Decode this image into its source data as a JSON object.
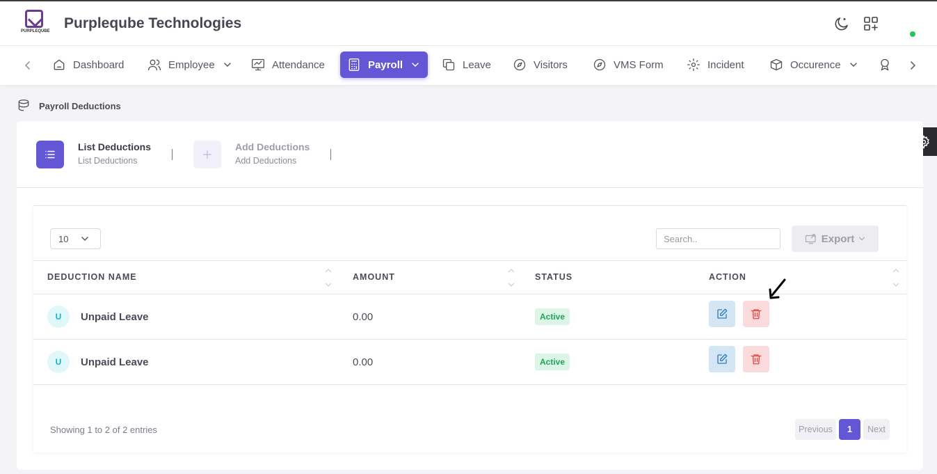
{
  "header": {
    "logo_text": "PURPLEQUBE",
    "company_name": "Purpleqube Technologies",
    "icons": [
      "moon-icon",
      "apps-icon"
    ],
    "status_color": "#22c55e"
  },
  "nav": {
    "items": [
      {
        "label": "Dashboard",
        "icon": "home-icon"
      },
      {
        "label": "Employee",
        "icon": "users-icon",
        "dropdown": true
      },
      {
        "label": "Attendance",
        "icon": "monitor-chart-icon"
      },
      {
        "label": "Payroll",
        "icon": "calculator-icon",
        "dropdown": true,
        "active": true
      },
      {
        "label": "Leave",
        "icon": "copy-icon"
      },
      {
        "label": "Visitors",
        "icon": "compass-icon"
      },
      {
        "label": "VMS Form",
        "icon": "compass-icon"
      },
      {
        "label": "Incident",
        "icon": "focus-icon"
      },
      {
        "label": "Occurence",
        "icon": "box-icon",
        "dropdown": true
      },
      {
        "label": "",
        "icon": "award-icon"
      }
    ],
    "accent_color": "#6457d6"
  },
  "breadcrumb": {
    "label": "Payroll Deductions"
  },
  "tabs": [
    {
      "title": "List Deductions",
      "subtitle": "List Deductions",
      "active": true,
      "icon": "list-icon"
    },
    {
      "title": "Add Deductions",
      "subtitle": "Add Deductions",
      "active": false,
      "icon": "plus-icon"
    }
  ],
  "table_controls": {
    "page_length": "10",
    "search_placeholder": "Search..",
    "export_label": "Export"
  },
  "table": {
    "columns": [
      "DEDUCTION NAME",
      "AMOUNT",
      "STATUS",
      "ACTION"
    ],
    "rows": [
      {
        "avatar": "U",
        "name": "Unpaid Leave",
        "amount": "0.00",
        "status": "Active"
      },
      {
        "avatar": "U",
        "name": "Unpaid Leave",
        "amount": "0.00",
        "status": "Active"
      }
    ]
  },
  "footer": {
    "info": "Showing 1 to 2 of 2 entries",
    "previous": "Previous",
    "page": "1",
    "next": "Next"
  }
}
